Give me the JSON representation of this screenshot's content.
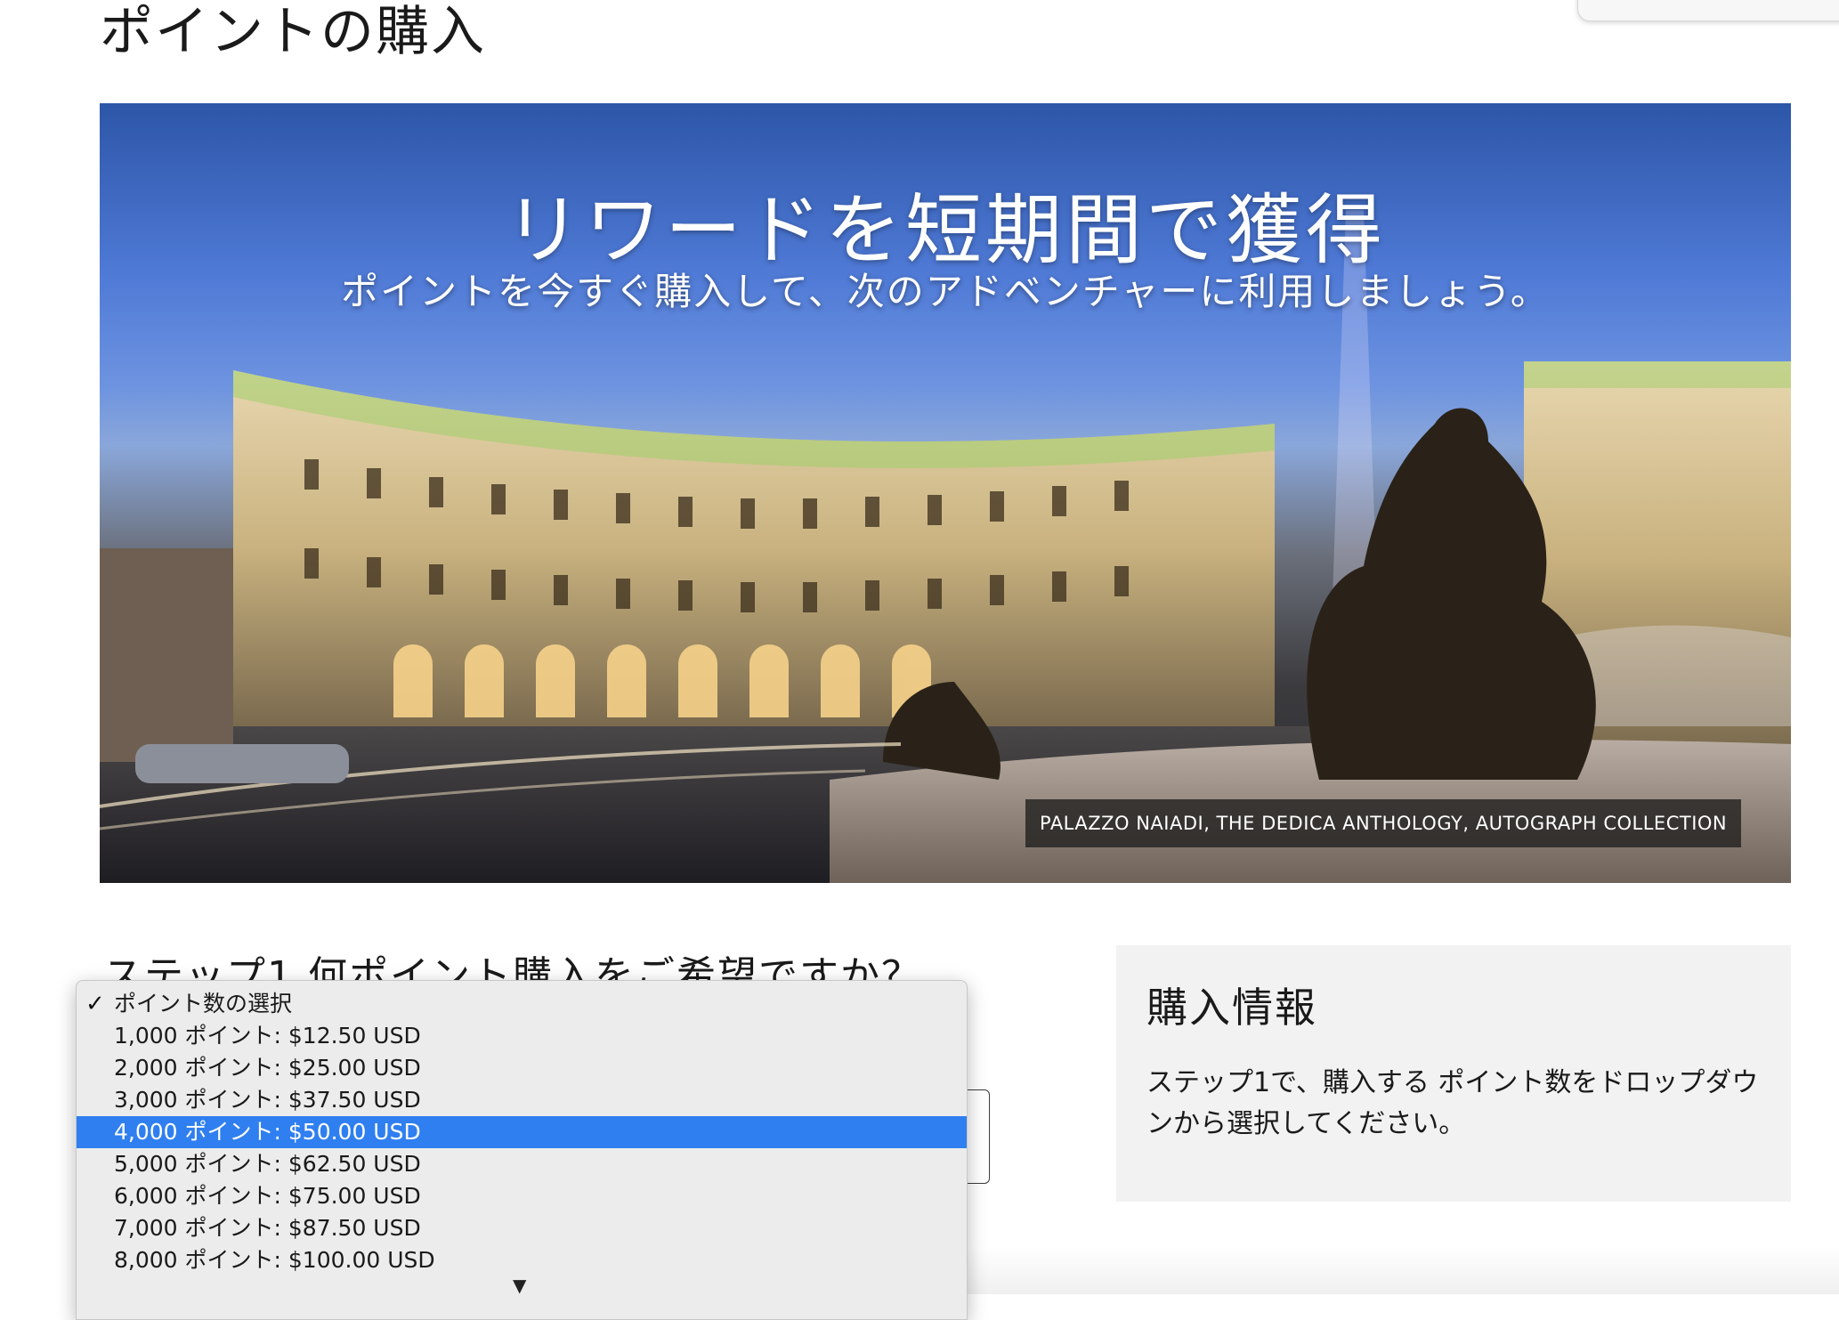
{
  "page": {
    "title": "ポイントの購入"
  },
  "hero": {
    "headline": "リワードを短期間で獲得",
    "subheadline": "ポイントを今すぐ購入して、次のアドベンチャーに利用しましょう。",
    "caption": "PALAZZO NAIADI, THE DEDICA ANTHOLOGY, AUTOGRAPH COLLECTION"
  },
  "step1": {
    "heading": "ステップ1 何ポイント購入をご希望ですか？"
  },
  "dropdown": {
    "options": [
      {
        "label": "ポイント数の選択",
        "checked": true,
        "highlighted": false
      },
      {
        "label": "1,000 ポイント: $12.50 USD",
        "checked": false,
        "highlighted": false
      },
      {
        "label": "2,000 ポイント: $25.00 USD",
        "checked": false,
        "highlighted": false
      },
      {
        "label": "3,000 ポイント: $37.50 USD",
        "checked": false,
        "highlighted": false
      },
      {
        "label": "4,000 ポイント: $50.00 USD",
        "checked": false,
        "highlighted": true
      },
      {
        "label": "5,000 ポイント: $62.50 USD",
        "checked": false,
        "highlighted": false
      },
      {
        "label": "6,000 ポイント: $75.00 USD",
        "checked": false,
        "highlighted": false
      },
      {
        "label": "7,000 ポイント: $87.50 USD",
        "checked": false,
        "highlighted": false
      },
      {
        "label": "8,000 ポイント: $100.00 USD",
        "checked": false,
        "highlighted": false
      }
    ],
    "check_mark": "✓",
    "scroll_indicator": "▼",
    "highlight_color": "#2f7ff0"
  },
  "info": {
    "title": "購入情報",
    "text": "ステップ1で、購入する ポイント数をドロップダウンから選択してください。"
  }
}
